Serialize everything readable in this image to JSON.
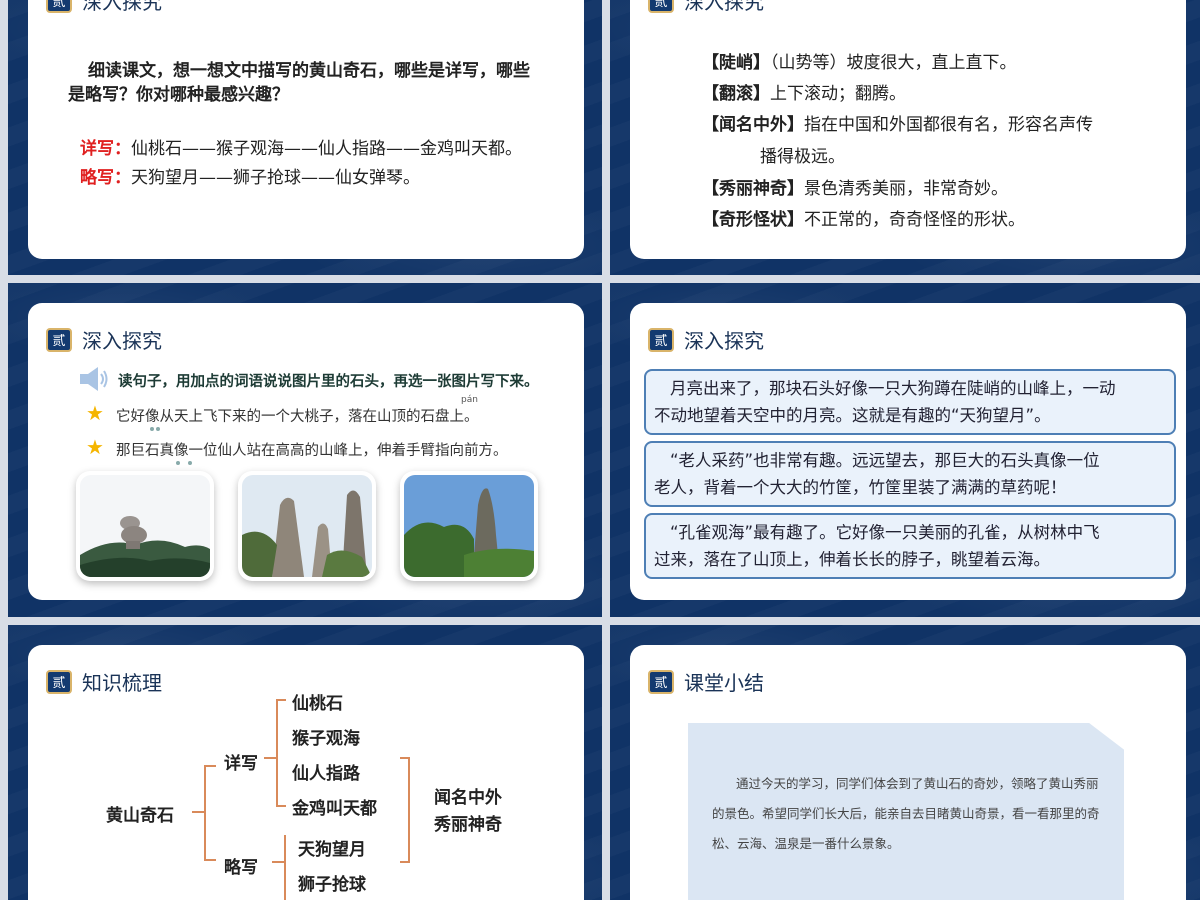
{
  "section_badge": "贰",
  "slide1": {
    "title": "深入探究",
    "question_line1": "细读课文，想一想文中描写的黄山奇石，哪些是详写，哪些",
    "question_line2": "是略写？你对哪种最感兴趣？",
    "detailed_label": "详写：",
    "detailed_text": "仙桃石——猴子观海——仙人指路——金鸡叫天都。",
    "brief_label": "略写：",
    "brief_text": "天狗望月——狮子抢球——仙女弹琴。"
  },
  "slide2": {
    "title": "深入探究",
    "definitions": [
      {
        "term": "【陡峭】",
        "text": "（山势等）坡度很大，直上直下。"
      },
      {
        "term": "【翻滚】",
        "text": "上下滚动；翻腾。"
      },
      {
        "term": "【闻名中外】",
        "text": "指在中国和外国都很有名，形容名声传"
      },
      {
        "term": "",
        "text": "播得极远。"
      },
      {
        "term": "【秀丽神奇】",
        "text": "景色清秀美丽，非常奇妙。"
      },
      {
        "term": "【奇形怪状】",
        "text": "不正常的，奇奇怪怪的形状。"
      }
    ]
  },
  "slide3": {
    "title": "深入探究",
    "instruction": "读句子，用加点的词语说说图片里的石头，再选一张图片写下来。",
    "pinyin": "pán",
    "sentence1": "它好像从天上飞下来的一个大桃子，落在山顶的石盘上。",
    "sentence2": "那巨石真像一位仙人站在高高的山峰上，伸着手臂指向前方。"
  },
  "slide4": {
    "title": "深入探究",
    "paragraphs": [
      [
        "月亮出来了，那块石头好像一只大狗蹲在陡峭的山峰上，一动",
        "不动地望着天空中的月亮。这就是有趣的“天狗望月”。"
      ],
      [
        "“老人采药”也非常有趣。远远望去，那巨大的石头真像一位",
        "老人，背着一个大大的竹筐，竹筐里装了满满的草药呢！"
      ],
      [
        "“孔雀观海”最有趣了。它好像一只美丽的孔雀，从树林中飞",
        "过来，落在了山顶上，伸着长长的脖子，眺望着云海。"
      ]
    ]
  },
  "slide5": {
    "title": "知识梳理",
    "root": "黄山奇石",
    "branch_detailed": "详写",
    "branch_brief": "略写",
    "detailed_items": [
      "仙桃石",
      "猴子观海",
      "仙人指路",
      "金鸡叫天都"
    ],
    "brief_items": [
      "天狗望月",
      "狮子抢球"
    ],
    "conclusion1": "闻名中外",
    "conclusion2": "秀丽神奇"
  },
  "slide6": {
    "title": "课堂小结",
    "summary_lines": [
      "通过今天的学习，同学们体会到了黄山石的奇妙，领略了黄山秀丽",
      "的景色。希望同学们长大后，能亲自去目睹黄山奇景，看一看那里的奇",
      "松、云海、温泉是一番什么景象。"
    ]
  }
}
